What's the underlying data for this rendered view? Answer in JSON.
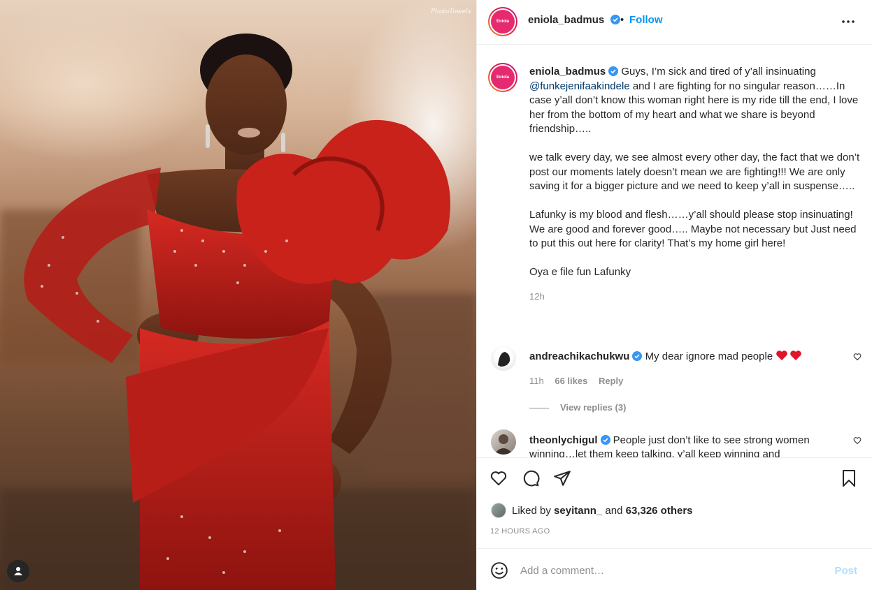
{
  "photo": {
    "watermark": "PhotoTowels",
    "alt": "Woman in red embellished gown"
  },
  "header": {
    "username": "eniola_badmus",
    "separator": "•",
    "follow_label": "Follow",
    "avatar_label": "Eniola"
  },
  "caption": {
    "username": "eniola_badmus",
    "paragraph1_pre": "Guys, I’m sick and tired of y’all insinuating ",
    "mention": "@funkejenifaakindele",
    "paragraph1_post": " and I are fighting for no singular reason……In case y’all don’t know this woman right here is my ride till the end, I love her from the bottom of my heart and what we share is beyond friendship…..",
    "paragraph2": "we talk every day, we see almost every other day, the fact that we don’t post our moments lately doesn’t mean we are fighting!!! We are only saving it for a bigger picture and we need to keep y’all in suspense…..",
    "paragraph3": "Lafunky is my blood and flesh……y’all should please stop insinuating! We are good and forever good….. Maybe not necessary but Just need to put this out here for clarity! That’s my home girl here!",
    "paragraph4": "Oya e file fun Lafunky",
    "time": "12h"
  },
  "comments": [
    {
      "username": "andreachikachukwu",
      "text": "My dear ignore mad people",
      "time": "11h",
      "likes": "66 likes",
      "reply_label": "Reply",
      "view_replies": "View replies (3)"
    },
    {
      "username": "theonlychigul",
      "text": "People just don’t like to see strong women winning…let them keep talking, y’all keep winning and"
    }
  ],
  "actions": {
    "liked_prefix": "Liked by",
    "liked_user": "seyitann_",
    "liked_and": "and",
    "liked_others": "63,326 others",
    "time_ago": "12 HOURS AGO"
  },
  "add_comment": {
    "placeholder": "Add a comment…",
    "post_label": "Post"
  },
  "colors": {
    "accent": "#0095f6",
    "verified": "#3897f0",
    "heart": "#ed4956"
  }
}
